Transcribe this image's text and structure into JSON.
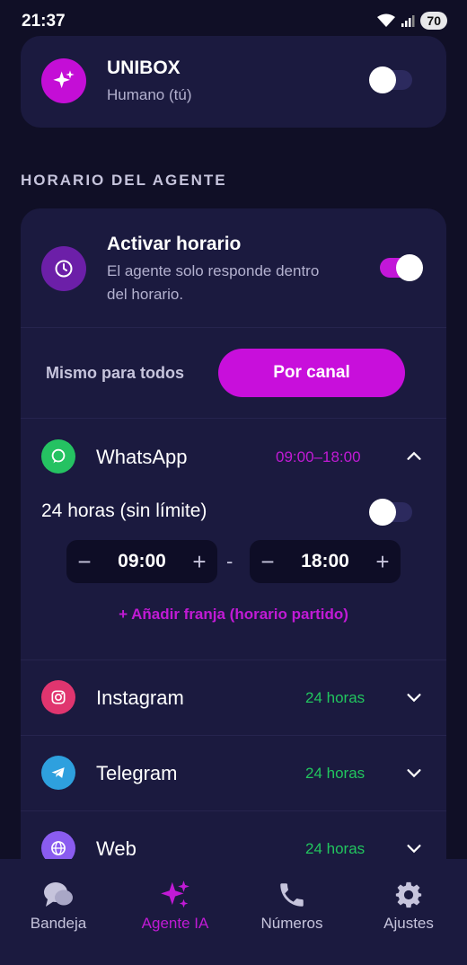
{
  "status_bar": {
    "time": "21:37",
    "battery": "70"
  },
  "unibox": {
    "title": "UNIBOX",
    "subtitle": "Humano (tú)",
    "enabled": false
  },
  "schedule_section": {
    "label": "HORARIO DEL AGENTE"
  },
  "schedule_card": {
    "title": "Activar horario",
    "description_line1": "El agente solo responde dentro",
    "description_line2": "del horario.",
    "enabled": true
  },
  "mode_switch": {
    "same_for_all": "Mismo para todos",
    "per_channel": "Por canal",
    "selected": "per_channel"
  },
  "channels": [
    {
      "name": "WhatsApp",
      "time": "09:00–18:00",
      "expanded": true,
      "icon": "whatsapp-icon",
      "color": "#25c262"
    },
    {
      "name": "Instagram",
      "time": "24 horas",
      "expanded": false,
      "icon": "instagram-icon",
      "color": "#e0356f"
    },
    {
      "name": "Telegram",
      "time": "24 horas",
      "expanded": false,
      "icon": "telegram-icon",
      "color": "#2ea0de"
    },
    {
      "name": "Web",
      "time": "24 horas",
      "expanded": false,
      "icon": "globe-icon",
      "color": "#8a5cf0"
    }
  ],
  "whatsapp_detail": {
    "all_day_label": "24 horas (sin límite)",
    "all_day_enabled": false,
    "start": "09:00",
    "end": "18:00",
    "separator": "-",
    "add_slot": "+ Añadir franja (horario partido)"
  },
  "bottom_nav": [
    {
      "label": "Bandeja",
      "icon": "chat-bubbles-icon",
      "active": false
    },
    {
      "label": "Agente IA",
      "icon": "sparkles-icon",
      "active": true
    },
    {
      "label": "Números",
      "icon": "phone-icon",
      "active": false
    },
    {
      "label": "Ajustes",
      "icon": "gear-icon",
      "active": false
    }
  ],
  "colors": {
    "background": "#100f26",
    "card": "#1b1a3f",
    "accent": "#c80fdb",
    "accent_text": "#c11ad5",
    "green_time": "#22c55e"
  }
}
